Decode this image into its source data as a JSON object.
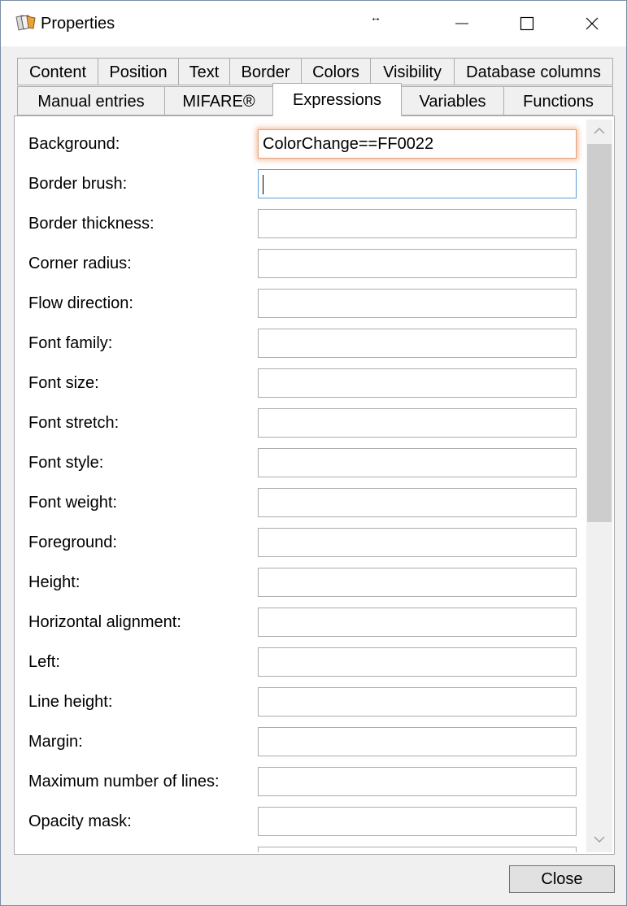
{
  "window": {
    "title": "Properties",
    "resize_glyph": "↔",
    "icons": [
      "app-icon",
      "minimize-icon",
      "maximize-icon",
      "close-icon"
    ]
  },
  "tabs": {
    "row1": [
      "Content",
      "Position",
      "Text",
      "Border",
      "Colors",
      "Visibility",
      "Database columns"
    ],
    "row2": [
      "Manual entries",
      "MIFARE®",
      "Expressions",
      "Variables",
      "Functions"
    ],
    "selected": "Expressions"
  },
  "fields": [
    {
      "label": "Background:",
      "value": "ColorChange==FF0022"
    },
    {
      "label": "Border brush:",
      "value": ""
    },
    {
      "label": "Border thickness:",
      "value": ""
    },
    {
      "label": "Corner radius:",
      "value": ""
    },
    {
      "label": "Flow direction:",
      "value": ""
    },
    {
      "label": "Font family:",
      "value": ""
    },
    {
      "label": "Font size:",
      "value": ""
    },
    {
      "label": "Font stretch:",
      "value": ""
    },
    {
      "label": "Font style:",
      "value": ""
    },
    {
      "label": "Font weight:",
      "value": ""
    },
    {
      "label": "Foreground:",
      "value": ""
    },
    {
      "label": "Height:",
      "value": ""
    },
    {
      "label": "Horizontal alignment:",
      "value": ""
    },
    {
      "label": "Left:",
      "value": ""
    },
    {
      "label": "Line height:",
      "value": ""
    },
    {
      "label": "Margin:",
      "value": ""
    },
    {
      "label": "Maximum number of lines:",
      "value": ""
    },
    {
      "label": "Opacity mask:",
      "value": ""
    }
  ],
  "close_button": "Close",
  "colors": {
    "highlight_glow": "#f4aa78",
    "focus_border": "#5b9bd5",
    "scroll_thumb": "#cdcdcd"
  }
}
